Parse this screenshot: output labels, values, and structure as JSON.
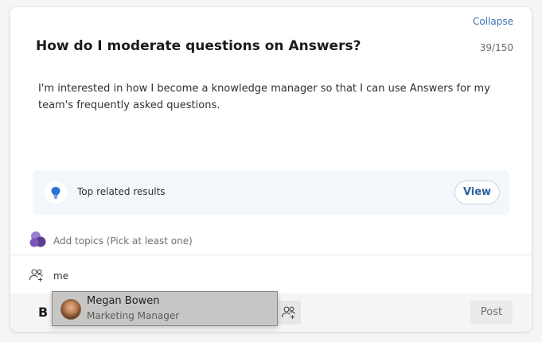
{
  "header": {
    "collapse_label": "Collapse",
    "title": "How do I moderate questions on Answers?",
    "counter": "39/150"
  },
  "body": {
    "text": "I'm interested in how I become a knowledge manager so that I can use Answers for my team's frequently asked questions."
  },
  "related": {
    "icon": "lightbulb-icon",
    "label": "Top related results",
    "view_label": "View"
  },
  "topics": {
    "icon": "topics-icon",
    "placeholder": "Add topics (Pick at least one)"
  },
  "people": {
    "icon": "people-add-icon",
    "input_value": "me"
  },
  "toolbar": {
    "bold_label": "B",
    "mention_icon": "people-add-icon",
    "post_label": "Post"
  },
  "suggestion": {
    "name": "Megan Bowen",
    "role": "Marketing Manager"
  },
  "colors": {
    "accent": "#3b6fb6",
    "bulb": "#2b73d6",
    "topics_purple": "#7a55b8"
  }
}
